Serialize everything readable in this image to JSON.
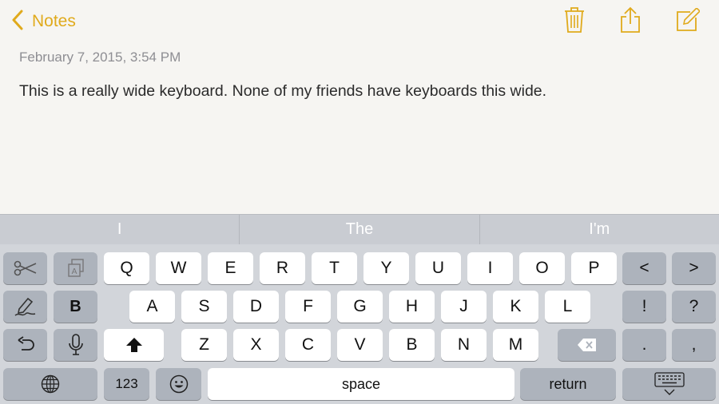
{
  "nav": {
    "back_label": "Notes"
  },
  "note": {
    "date": "February 7, 2015, 3:54 PM",
    "body": "This is a really wide keyboard. None of my friends have keyboards this wide."
  },
  "predictions": [
    "I",
    "The",
    "I'm"
  ],
  "keyboard": {
    "row1": [
      "Q",
      "W",
      "E",
      "R",
      "T",
      "Y",
      "U",
      "I",
      "O",
      "P"
    ],
    "row2": [
      "A",
      "S",
      "D",
      "F",
      "G",
      "H",
      "J",
      "K",
      "L"
    ],
    "row3": [
      "Z",
      "X",
      "C",
      "V",
      "B",
      "N",
      "M"
    ],
    "bold_label": "B",
    "exclaim_label": "!",
    "question_label": "?",
    "period_label": ".",
    "comma_label": ",",
    "numbers_label": "123",
    "space_label": "space",
    "return_label": "return",
    "cursor_left_label": "<",
    "cursor_right_label": ">"
  },
  "icons": {
    "back": "chevron-left-icon",
    "trash": "trash-icon",
    "share": "share-icon",
    "compose": "compose-icon",
    "cut": "scissors-icon",
    "copy": "copy-icon",
    "handwriting": "pen-icon",
    "undo": "undo-icon",
    "dictation": "microphone-icon",
    "shift": "shift-icon",
    "globe": "globe-icon",
    "emoji": "emoji-icon",
    "delete": "delete-icon",
    "dismiss": "keyboard-dismiss-icon"
  },
  "colors": {
    "accent": "#e0aa1c",
    "keyboard_bg": "#d2d5da",
    "key_bg": "#ffffff",
    "function_key_bg": "#adb3bc"
  }
}
